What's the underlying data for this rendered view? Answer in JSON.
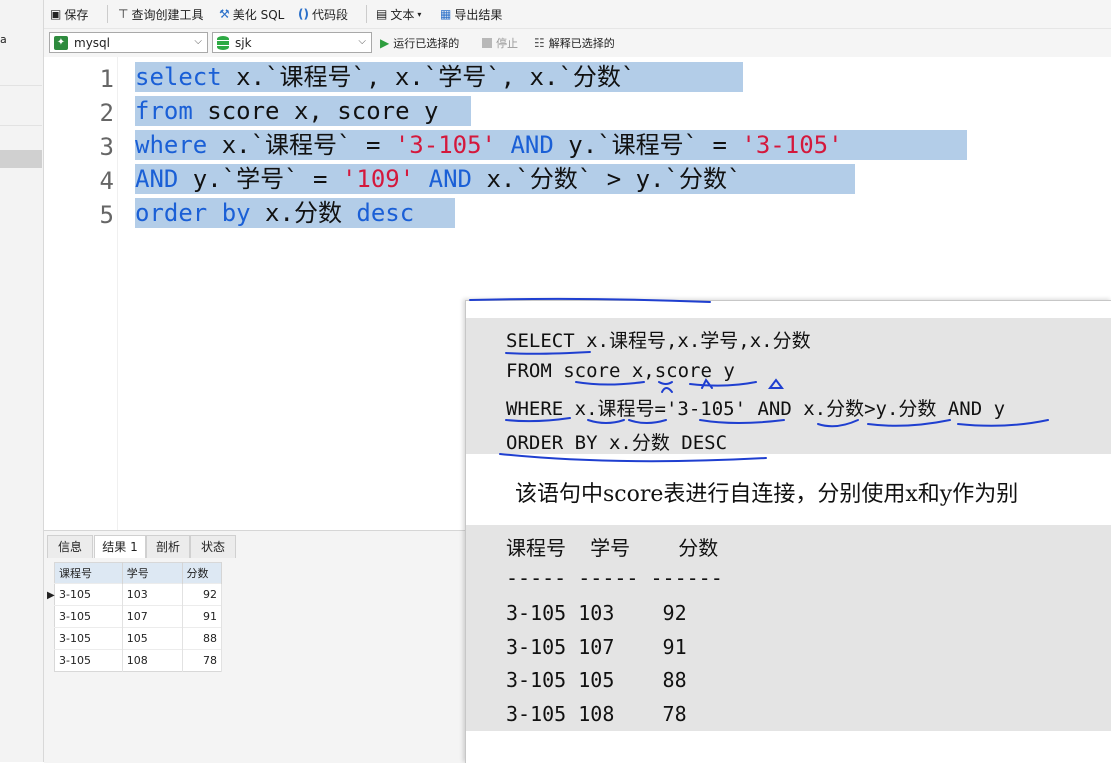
{
  "left_pane": {
    "fragment": "a"
  },
  "toolbar": {
    "save": "保存",
    "query_builder": "查询创建工具",
    "beautify": "美化 SQL",
    "snippet": "代码段",
    "text": "文本",
    "export": "导出结果"
  },
  "connection_bar": {
    "connection": "mysql",
    "database": "sjk",
    "run_selected": "运行已选择的",
    "stop": "停止",
    "explain_selected": "解释已选择的"
  },
  "editor": {
    "line_numbers": [
      "1",
      "2",
      "3",
      "4",
      "5"
    ]
  },
  "result_tabs": [
    "信息",
    "结果 1",
    "剖析",
    "状态"
  ],
  "result_grid": {
    "columns": [
      "课程号",
      "学号",
      "分数"
    ],
    "rows": [
      [
        "3-105",
        "103",
        "92"
      ],
      [
        "3-105",
        "107",
        "91"
      ],
      [
        "3-105",
        "105",
        "88"
      ],
      [
        "3-105",
        "108",
        "78"
      ]
    ]
  },
  "slide": {
    "code_lines": [
      "SELECT x.课程号,x.学号,x.分数",
      "FROM score x,score y",
      "WHERE x.课程号='3-105' AND x.分数>y.分数 AND y",
      "ORDER BY x.分数 DESC"
    ],
    "note": "该语句中score表进行自连接，分别使用x和y作为别",
    "result_header": "课程号  学号    分数",
    "result_divider": "----- ----- ------",
    "result_rows": [
      "3-105 103    92",
      "3-105 107    91",
      "3-105 105    88",
      "3-105 108    78"
    ]
  },
  "colors": {
    "keyword": "#1a5fd6",
    "string": "#d4183c",
    "selection": "#b3cde8",
    "annotation": "#1f3fd0"
  }
}
